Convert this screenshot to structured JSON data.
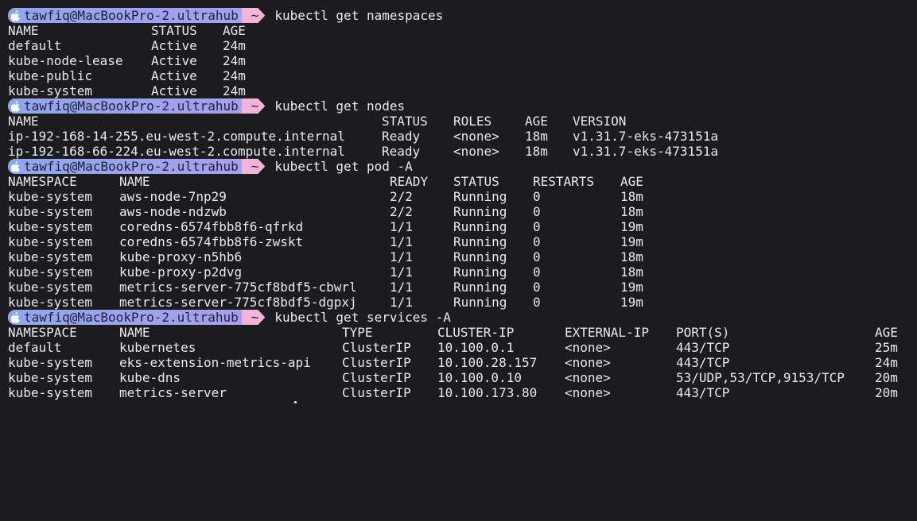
{
  "prompt": {
    "user_host": "tawfiq@MacBookPro-2.ultrahub",
    "directory": "~"
  },
  "commands": {
    "namespaces": "kubectl get namespaces",
    "nodes": "kubectl get nodes",
    "pods": "kubectl get pod -A",
    "services": "kubectl get services -A"
  },
  "namespaces": {
    "headers": [
      "NAME",
      "STATUS",
      "AGE"
    ],
    "rows": [
      [
        "default",
        "Active",
        "24m"
      ],
      [
        "kube-node-lease",
        "Active",
        "24m"
      ],
      [
        "kube-public",
        "Active",
        "24m"
      ],
      [
        "kube-system",
        "Active",
        "24m"
      ]
    ]
  },
  "nodes": {
    "headers": [
      "NAME",
      "STATUS",
      "ROLES",
      "AGE",
      "VERSION"
    ],
    "rows": [
      [
        "ip-192-168-14-255.eu-west-2.compute.internal",
        "Ready",
        "<none>",
        "18m",
        "v1.31.7-eks-473151a"
      ],
      [
        "ip-192-168-66-224.eu-west-2.compute.internal",
        "Ready",
        "<none>",
        "18m",
        "v1.31.7-eks-473151a"
      ]
    ]
  },
  "pods": {
    "headers": [
      "NAMESPACE",
      "NAME",
      "READY",
      "STATUS",
      "RESTARTS",
      "AGE"
    ],
    "rows": [
      [
        "kube-system",
        "aws-node-7np29",
        "2/2",
        "Running",
        "0",
        "18m"
      ],
      [
        "kube-system",
        "aws-node-ndzwb",
        "2/2",
        "Running",
        "0",
        "18m"
      ],
      [
        "kube-system",
        "coredns-6574fbb8f6-qfrkd",
        "1/1",
        "Running",
        "0",
        "19m"
      ],
      [
        "kube-system",
        "coredns-6574fbb8f6-zwskt",
        "1/1",
        "Running",
        "0",
        "19m"
      ],
      [
        "kube-system",
        "kube-proxy-n5hb6",
        "1/1",
        "Running",
        "0",
        "18m"
      ],
      [
        "kube-system",
        "kube-proxy-p2dvg",
        "1/1",
        "Running",
        "0",
        "18m"
      ],
      [
        "kube-system",
        "metrics-server-775cf8bdf5-cbwrl",
        "1/1",
        "Running",
        "0",
        "19m"
      ],
      [
        "kube-system",
        "metrics-server-775cf8bdf5-dgpxj",
        "1/1",
        "Running",
        "0",
        "19m"
      ]
    ]
  },
  "services": {
    "headers": [
      "NAMESPACE",
      "NAME",
      "TYPE",
      "CLUSTER-IP",
      "EXTERNAL-IP",
      "PORT(S)",
      "AGE"
    ],
    "rows": [
      [
        "default",
        "kubernetes",
        "ClusterIP",
        "10.100.0.1",
        "<none>",
        "443/TCP",
        "25m"
      ],
      [
        "kube-system",
        "eks-extension-metrics-api",
        "ClusterIP",
        "10.100.28.157",
        "<none>",
        "443/TCP",
        "24m"
      ],
      [
        "kube-system",
        "kube-dns",
        "ClusterIP",
        "10.100.0.10",
        "<none>",
        "53/UDP,53/TCP,9153/TCP",
        "20m"
      ],
      [
        "kube-system",
        "metrics-server",
        "ClusterIP",
        "10.100.173.80",
        "<none>",
        "443/TCP",
        "20m"
      ]
    ]
  },
  "colors": {
    "background": "#1c1c1e",
    "text": "#e9e9ee",
    "prompt_user_bg": "#8fa6ee",
    "prompt_dir_bg": "#f4b4d8"
  }
}
